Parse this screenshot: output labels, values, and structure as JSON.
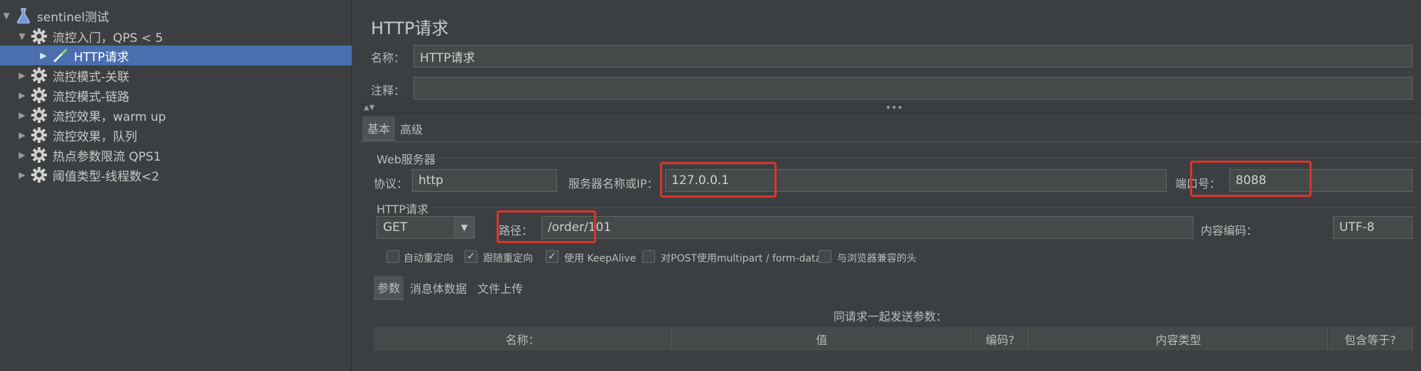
{
  "tree": {
    "root_label": "sentinel测试",
    "items": [
      {
        "label": "流控入门，QPS < 5",
        "icon": "gear-icon"
      },
      {
        "label": "HTTP请求",
        "icon": "pipette-icon"
      },
      {
        "label": "流控模式-关联",
        "icon": "gear-icon"
      },
      {
        "label": "流控模式-链路",
        "icon": "gear-icon"
      },
      {
        "label": "流控效果，warm up",
        "icon": "gear-icon"
      },
      {
        "label": "流控效果，队列",
        "icon": "gear-icon"
      },
      {
        "label": "热点参数限流 QPS1",
        "icon": "gear-icon"
      },
      {
        "label": "阈值类型-线程数<2",
        "icon": "gear-icon"
      }
    ]
  },
  "panel": {
    "title": "HTTP请求",
    "name_label": "名称：",
    "name_value": "HTTP请求",
    "comment_label": "注释：",
    "comment_value": ""
  },
  "config_tabs": [
    "基本",
    "高级"
  ],
  "web_server": {
    "section_label": "Web服务器",
    "protocol_label": "协议：",
    "protocol_value": "http",
    "server_label": "服务器名称或IP：",
    "server_value": "127.0.0.1",
    "port_label": "端口号：",
    "port_value": "8088"
  },
  "http_request": {
    "section_label": "HTTP请求",
    "method": "GET",
    "path_label": "路径：",
    "path_value": "/order/101",
    "encoding_label": "内容编码：",
    "encoding_value": "UTF-8"
  },
  "options": [
    {
      "label": "自动重定向",
      "checked": false
    },
    {
      "label": "跟随重定向",
      "checked": true
    },
    {
      "label": "使用 KeepAlive",
      "checked": true
    },
    {
      "label": "对POST使用multipart / form-data",
      "checked": false
    },
    {
      "label": "与浏览器兼容的头",
      "checked": false
    }
  ],
  "param_tabs": [
    "参数",
    "消息体数据",
    "文件上传"
  ],
  "params_table": {
    "caption": "同请求一起发送参数：",
    "columns": [
      "名称：",
      "值",
      "编码?",
      "内容类型",
      "包含等于?"
    ]
  },
  "colors": {
    "background": "#3c3f41",
    "selection": "#4b6eaf",
    "highlight_box": "#d9362b"
  }
}
